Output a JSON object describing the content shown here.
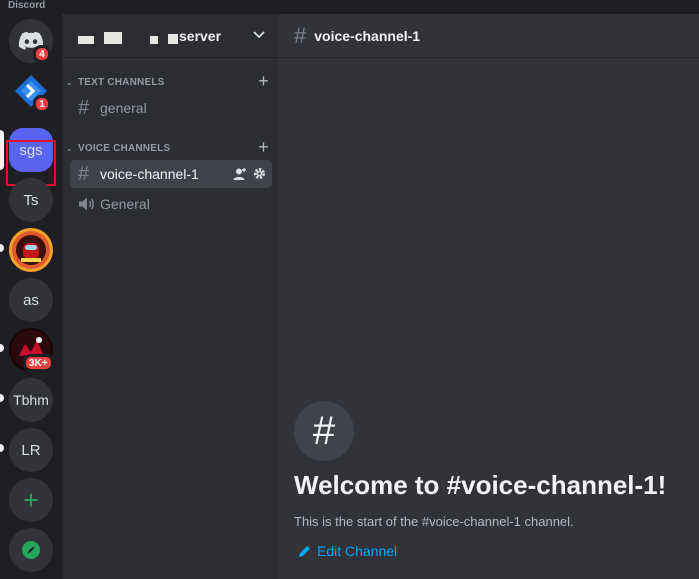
{
  "app": {
    "name": "Discord"
  },
  "guilds": [
    {
      "id": "home",
      "label": "",
      "badge": "4"
    },
    {
      "id": "g2",
      "label": "",
      "badge": "1"
    },
    {
      "id": "sgs",
      "label": "sgs",
      "badge": ""
    },
    {
      "id": "ts",
      "label": "Ts",
      "badge": ""
    },
    {
      "id": "g5",
      "label": "",
      "badge": ""
    },
    {
      "id": "as",
      "label": "as",
      "badge": ""
    },
    {
      "id": "g7",
      "label": "",
      "badge": "3K+"
    },
    {
      "id": "tbhm",
      "label": "Tbhm",
      "badge": ""
    },
    {
      "id": "lr",
      "label": "LR",
      "badge": ""
    }
  ],
  "colors": {
    "blurple": "#5865f2",
    "green": "#23a55a",
    "red": "#f23f43",
    "link": "#00a8fc"
  },
  "server": {
    "name": "server"
  },
  "categories": {
    "text": "TEXT CHANNELS",
    "voice": "VOICE CHANNELS"
  },
  "channels": {
    "text": [
      {
        "name": "general"
      }
    ],
    "voice": [
      {
        "name": "voice-channel-1"
      },
      {
        "name": "General"
      }
    ]
  },
  "main": {
    "header_title": "voice-channel-1",
    "welcome_title": "Welcome to #voice-channel-1!",
    "welcome_sub": "This is the start of the #voice-channel-1 channel.",
    "edit_label": "Edit Channel"
  },
  "icons": [
    "discord-logo-icon",
    "hash-icon",
    "speaker-icon",
    "plus-icon",
    "chevron-down-icon",
    "add-member-icon",
    "gear-icon",
    "compass-icon",
    "pencil-icon"
  ]
}
